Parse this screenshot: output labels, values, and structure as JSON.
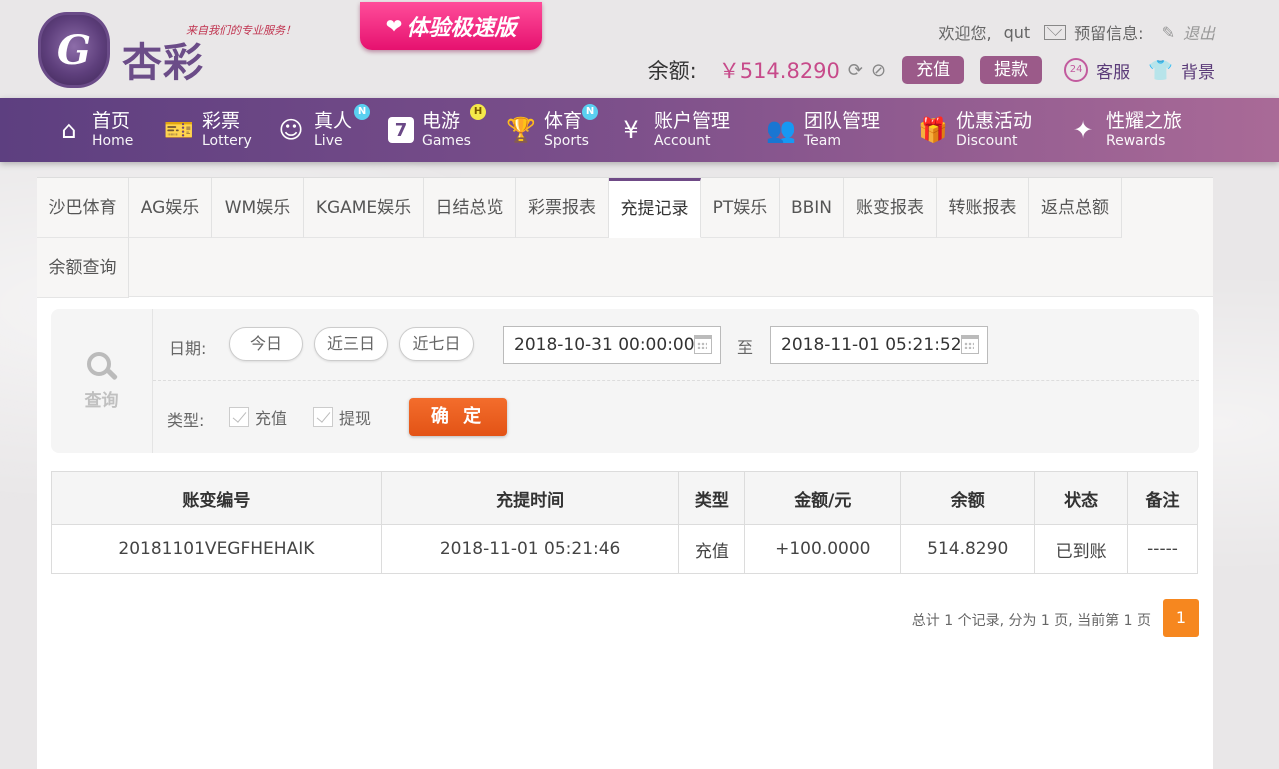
{
  "header": {
    "logo_mark": "G",
    "logo_text": "杏彩",
    "slogan": "来自我们的专业服务！",
    "speed_button": "体验极速版",
    "welcome": "欢迎您,",
    "username": "qut",
    "reserved_info": "预留信息:",
    "logout": "退出",
    "balance_label": "余额:",
    "balance_value": "￥514.8290",
    "deposit": "充值",
    "withdraw": "提款",
    "customer_service": "客服",
    "background": "背景"
  },
  "nav": [
    {
      "cn": "首页",
      "en": "Home",
      "icon": "home-icon",
      "badge": ""
    },
    {
      "cn": "彩票",
      "en": "Lottery",
      "icon": "lottery-icon",
      "badge": ""
    },
    {
      "cn": "真人",
      "en": "Live",
      "icon": "live-icon",
      "badge": "N"
    },
    {
      "cn": "电游",
      "en": "Games",
      "icon": "games-icon",
      "badge": "H"
    },
    {
      "cn": "体育",
      "en": "Sports",
      "icon": "trophy-icon",
      "badge": "N"
    },
    {
      "cn": "账户管理",
      "en": "Account",
      "icon": "account-icon",
      "badge": ""
    },
    {
      "cn": "团队管理",
      "en": "Team",
      "icon": "team-icon",
      "badge": ""
    },
    {
      "cn": "优惠活动",
      "en": "Discount",
      "icon": "gift-icon",
      "badge": ""
    },
    {
      "cn": "性耀之旅",
      "en": "Rewards",
      "icon": "rewards-icon",
      "badge": ""
    }
  ],
  "tabs": [
    "沙巴体育",
    "AG娱乐",
    "WM娱乐",
    "KGAME娱乐",
    "日结总览",
    "彩票报表",
    "充提记录",
    "PT娱乐",
    "BBIN",
    "账变报表",
    "转账报表",
    "返点总额",
    "余额查询"
  ],
  "active_tab": "充提记录",
  "search": {
    "side_label": "查询",
    "date_label": "日期:",
    "chips": [
      "今日",
      "近三日",
      "近七日"
    ],
    "date_from": "2018-10-31 00:00:00",
    "to_label": "至",
    "date_to": "2018-11-01 05:21:52",
    "type_label": "类型:",
    "types": [
      "充值",
      "提现"
    ],
    "confirm": "确 定"
  },
  "table": {
    "headers": [
      "账变编号",
      "充提时间",
      "类型",
      "金额/元",
      "余额",
      "状态",
      "备注"
    ],
    "rows": [
      [
        "20181101VEGFHEHAIK",
        "2018-11-01 05:21:46",
        "充值",
        "+100.0000",
        "514.8290",
        "已到账",
        "-----"
      ]
    ]
  },
  "pager": {
    "summary": "总计 1 个记录, 分为 1 页, 当前第 1 页",
    "current": "1"
  },
  "colors": {
    "nav_start": "#5d3f80",
    "nav_end": "#a96a97",
    "accent": "#9b5a89",
    "confirm": "#e35316",
    "pager_active": "#f6871f",
    "amount": "#c81e1e",
    "status_ok": "#2ea52e"
  }
}
